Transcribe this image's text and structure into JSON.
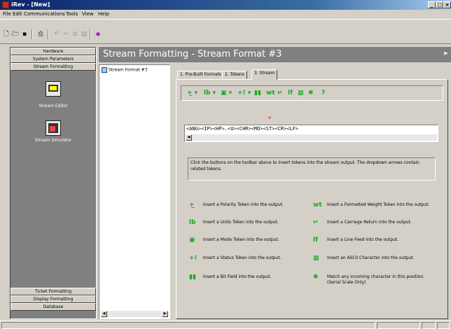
{
  "window": {
    "title": "iRev - [New]"
  },
  "menu": [
    "File",
    "Edit",
    "Communications",
    "Tools",
    "View",
    "Help"
  ],
  "nav": {
    "top_items": [
      "Hardware",
      "System Parameters",
      "Stream Formatting"
    ],
    "tools": [
      "Stream Editor",
      "Stream Simulator"
    ],
    "bottom_items": [
      "Ticket Formatting",
      "Display Formatting",
      "Database"
    ]
  },
  "header": {
    "title": "Stream Formatting - Stream Format #3"
  },
  "tree": {
    "node": "Stream Format #3"
  },
  "tabs": [
    "1. Pre-Built Formats",
    "2. Tokens",
    "3. Stream"
  ],
  "stream": {
    "content": "<ANG><IP><HP>.<U><CHR><MO><ST><CR><LF>"
  },
  "info": "Click the buttons on the toolbar above to insert tokens into the stream output. The dropdown arrows contain related tokens.",
  "legend_left": [
    "Insert a Polarity Token into the output.",
    "Insert a Units Token into the output.",
    "Insert a Mode Token into the output.",
    "Insert a Status Token into the output.",
    "Insert a Bit Field into the output."
  ],
  "legend_right": [
    "Insert a Formatted Weight Token into the output.",
    "Insert a Carriage Return into the output.",
    "Insert a Line Feed into the output.",
    "Insert an ASCII Character into the output.",
    "Match any incoming character in this position. (Serial Scale Only)"
  ]
}
